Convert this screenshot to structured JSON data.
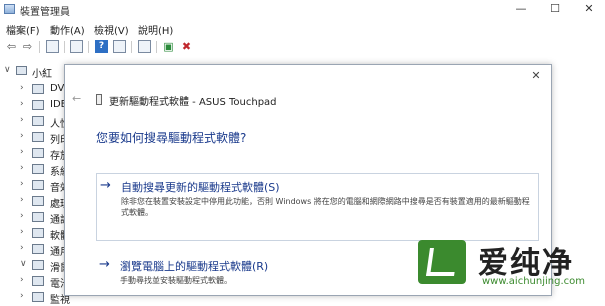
{
  "window": {
    "title": "裝置管理員",
    "min_glyph": "—",
    "max_glyph": "☐",
    "close_glyph": "✕"
  },
  "menu": {
    "items": [
      "檔案(F)",
      "動作(A)",
      "檢視(V)",
      "說明(H)"
    ]
  },
  "toolbar": {
    "back_glyph": "⇦",
    "forward_glyph": "⇨",
    "help_glyph": "?"
  },
  "tree": {
    "root": "小紅",
    "items": [
      {
        "label": "DV",
        "icon": "dvd-icon"
      },
      {
        "label": "IDE",
        "icon": "ide-icon"
      },
      {
        "label": "人性",
        "icon": "hid-icon"
      },
      {
        "label": "列印",
        "icon": "print-icon"
      },
      {
        "label": "存放",
        "icon": "storage-icon"
      },
      {
        "label": "系統",
        "icon": "system-icon"
      },
      {
        "label": "音效",
        "icon": "audio-icon"
      },
      {
        "label": "處理",
        "icon": "processor-icon"
      },
      {
        "label": "通訊",
        "icon": "port-icon"
      },
      {
        "label": "軟體",
        "icon": "software-icon"
      },
      {
        "label": "通用",
        "icon": "usb-icon"
      },
      {
        "label": "滑鼠",
        "icon": "mouse-icon"
      },
      {
        "label": "電池",
        "icon": "battery-icon"
      },
      {
        "label": "監視",
        "icon": "monitor-icon"
      }
    ]
  },
  "dialog": {
    "close_glyph": "✕",
    "back_glyph": "←",
    "title": "更新驅動程式軟體 - ASUS Touchpad",
    "question": "您要如何搜尋驅動程式軟體?",
    "options": [
      {
        "arrow": "→",
        "title": "自動搜尋更新的驅動程式軟體(S)",
        "description": "除非您在裝置安裝設定中停用此功能，否則 Windows 將在您的電腦和網際網路中搜尋是否有裝置適用的最新驅動程式軟體。"
      },
      {
        "arrow": "→",
        "title": "瀏覽電腦上的驅動程式軟體(R)",
        "description": "手動尋找並安裝驅動程式軟體。"
      }
    ]
  },
  "watermark": {
    "text": "爱纯净",
    "url": "www.aichunjing.com",
    "color": "#3b8a2e"
  }
}
